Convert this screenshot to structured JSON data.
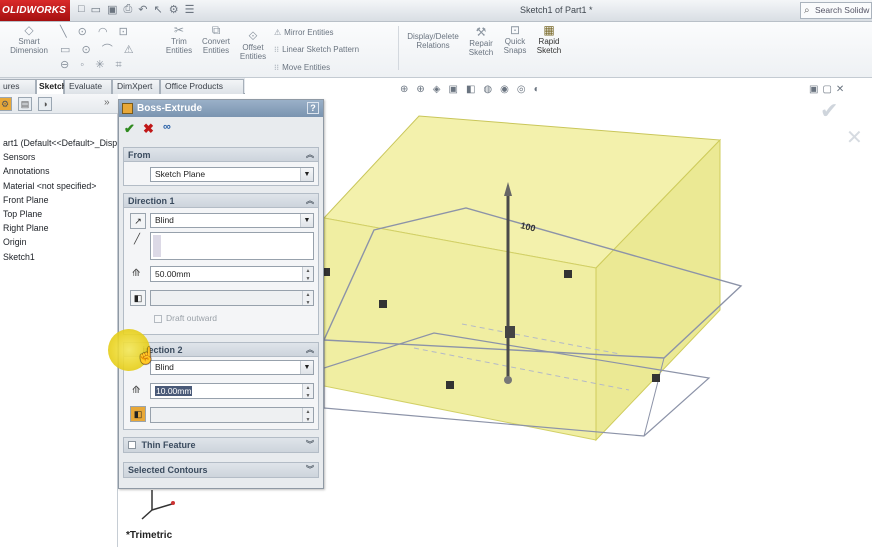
{
  "app": {
    "logo": "OLIDWORKS",
    "document_title": "Sketch1 of Part1 *",
    "search_placeholder": "Search Solidw"
  },
  "ribbon": {
    "smart_dimension": "Smart\nDimension",
    "trim_entities": "Trim\nEntities",
    "convert_entities": "Convert\nEntities",
    "offset_entities": "Offset\nEntities",
    "mirror_entities": "Mirror Entities",
    "linear_pattern": "Linear Sketch Pattern",
    "move_entities": "Move Entities",
    "display_delete": "Display/Delete\nRelations",
    "repair_sketch": "Repair\nSketch",
    "quick_snaps": "Quick\nSnaps",
    "rapid_sketch": "Rapid\nSketch"
  },
  "tabs": [
    {
      "label": "ures"
    },
    {
      "label": "Sketch",
      "active": true
    },
    {
      "label": "Evaluate"
    },
    {
      "label": "DimXpert"
    },
    {
      "label": "Office Products"
    }
  ],
  "tree": {
    "items": [
      "art1  (Default<<Default>_Disp",
      "Sensors",
      "Annotations",
      "Material <not specified>",
      "Front Plane",
      "Top Plane",
      "Right Plane",
      "Origin",
      "Sketch1"
    ]
  },
  "pm": {
    "title": "Boss-Extrude",
    "help": "?",
    "from": {
      "header": "From",
      "value": "Sketch Plane"
    },
    "direction1": {
      "header": "Direction 1",
      "end_condition": "Blind",
      "depth": "50.00mm",
      "draft_label": "Draft outward"
    },
    "direction2": {
      "header": "irection 2",
      "end_condition": "Blind",
      "depth": "10.00mm"
    },
    "thin_feature": "Thin Feature",
    "selected_contours": "Selected Contours"
  },
  "viewport": {
    "dimension_label": "100",
    "orientation": "*Trimetric"
  },
  "colors": {
    "preview_face_top": "#f2f0a8",
    "preview_face_side": "#ecea9a",
    "accent_logo": "#c41c1c",
    "pm_header": "#8aa2bc"
  }
}
